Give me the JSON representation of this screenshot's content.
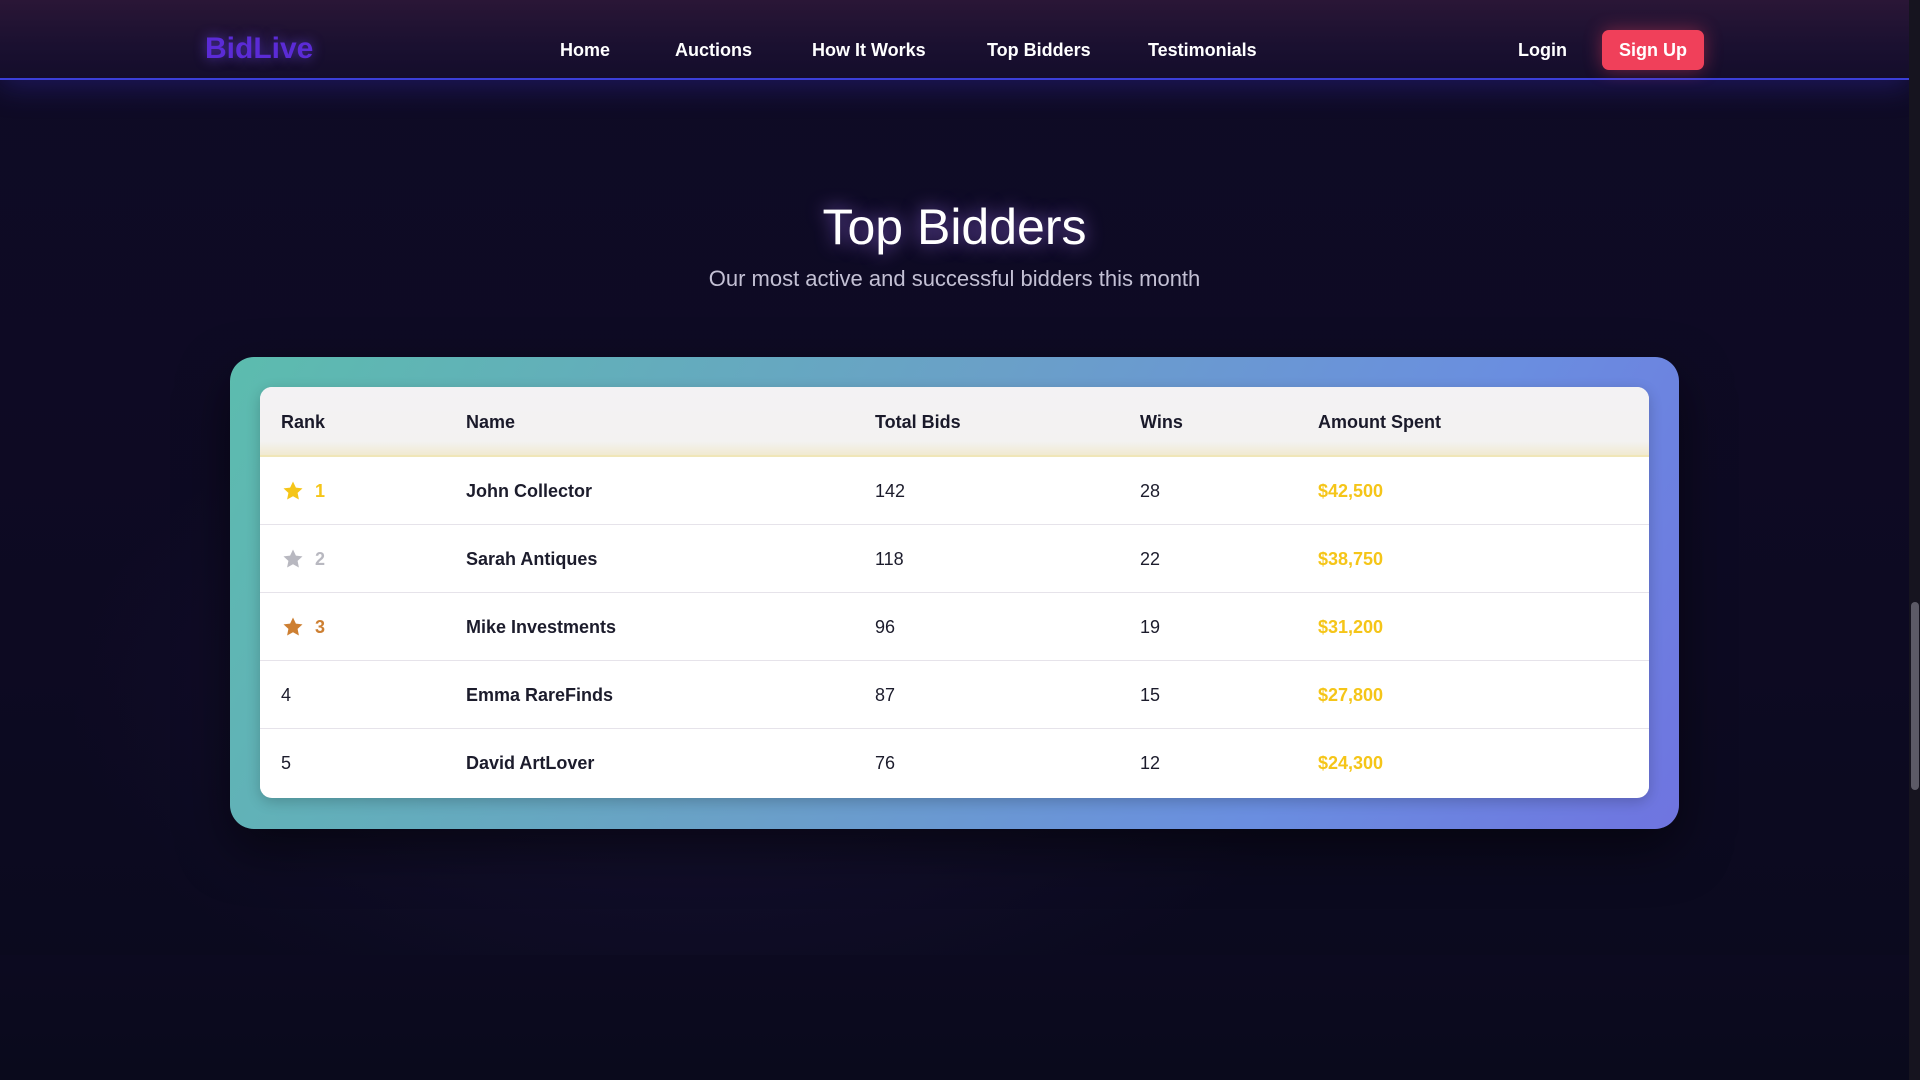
{
  "brand": {
    "logo": "BidLive"
  },
  "nav": {
    "items": [
      {
        "label": "Home"
      },
      {
        "label": "Auctions"
      },
      {
        "label": "How It Works"
      },
      {
        "label": "Top Bidders"
      },
      {
        "label": "Testimonials"
      }
    ],
    "login_label": "Login",
    "signup_label": "Sign Up"
  },
  "section": {
    "title": "Top Bidders",
    "subtitle": "Our most active and successful bidders this month"
  },
  "table": {
    "columns": [
      "Rank",
      "Name",
      "Total Bids",
      "Wins",
      "Amount Spent"
    ],
    "rows": [
      {
        "rank": "1",
        "medal": "gold",
        "name": "John Collector",
        "bids": "142",
        "wins": "28",
        "amount": "$42,500"
      },
      {
        "rank": "2",
        "medal": "silver",
        "name": "Sarah Antiques",
        "bids": "118",
        "wins": "22",
        "amount": "$38,750"
      },
      {
        "rank": "3",
        "medal": "bronze",
        "name": "Mike Investments",
        "bids": "96",
        "wins": "19",
        "amount": "$31,200"
      },
      {
        "rank": "4",
        "medal": "",
        "name": "Emma RareFinds",
        "bids": "87",
        "wins": "15",
        "amount": "$27,800"
      },
      {
        "rank": "5",
        "medal": "",
        "name": "David ArtLover",
        "bids": "76",
        "wins": "12",
        "amount": "$24,300"
      }
    ]
  },
  "colors": {
    "accent": "#f0405a",
    "brand": "#5b2bd6",
    "amount": "#f5c518",
    "gold": "#f5c518",
    "silver": "#b8b8c0",
    "bronze": "#cd7f32"
  },
  "icons": {
    "rank_medal": "star-icon"
  }
}
